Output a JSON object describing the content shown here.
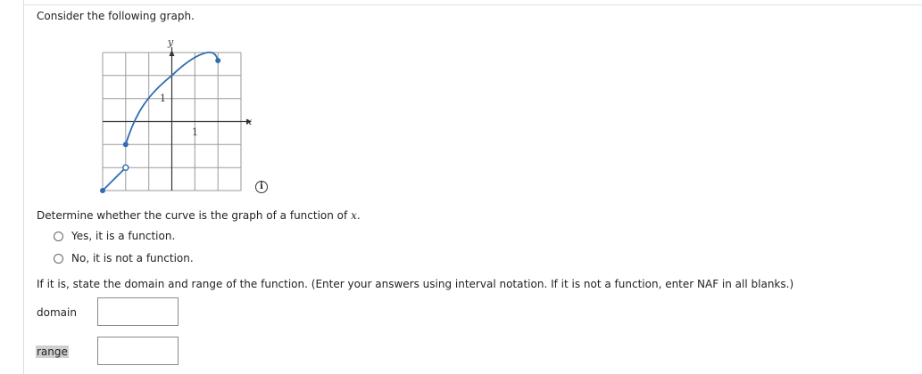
{
  "prompt": "Consider the following graph.",
  "graph": {
    "y_axis_letter": "y",
    "x_axis_letter": "x",
    "y_tick_label": "1",
    "x_tick_label": "1",
    "curve_color": "#2e6db4",
    "icon": "info-icon",
    "icon_glyph": "i"
  },
  "question": {
    "text_before": "Determine whether the curve is the graph of a function of ",
    "variable": "x",
    "text_after": "."
  },
  "options": [
    {
      "label": "Yes, it is a function.",
      "selected": false
    },
    {
      "label": "No, it is not a function.",
      "selected": false
    }
  ],
  "instructions": "If it is, state the domain and range of the function. (Enter your answers using interval notation. If it is not a function, enter NAF in all blanks.)",
  "fields": {
    "domain_label": "domain",
    "domain_value": "",
    "range_label": "range",
    "range_value": ""
  }
}
